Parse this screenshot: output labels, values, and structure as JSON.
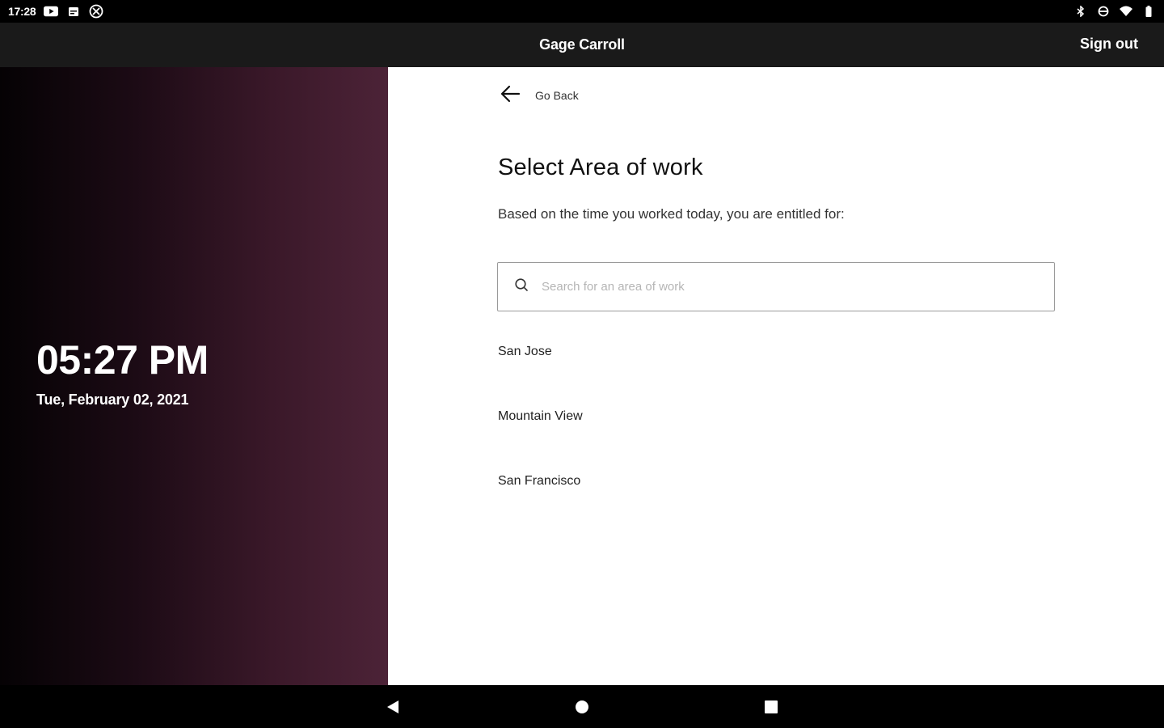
{
  "status_bar": {
    "time": "17:28",
    "left_icons": [
      "youtube-icon",
      "calendar-icon",
      "settings-badge-icon"
    ],
    "right_icons": [
      "bluetooth-icon",
      "data-saver-icon",
      "wifi-icon",
      "battery-icon"
    ]
  },
  "header": {
    "title": "Gage Carroll",
    "sign_out_label": "Sign out"
  },
  "clock": {
    "time": "05:27 PM",
    "date": "Tue, February 02, 2021"
  },
  "content": {
    "go_back_label": "Go Back",
    "title": "Select Area of work",
    "subtitle": "Based on the time you worked today, you are entitled for:",
    "search": {
      "placeholder": "Search for an area of work",
      "value": ""
    },
    "areas": [
      {
        "label": "San Jose"
      },
      {
        "label": "Mountain View"
      },
      {
        "label": "San Francisco"
      }
    ]
  },
  "nav_bar": {
    "buttons": [
      "back-icon",
      "home-icon",
      "recents-icon"
    ]
  },
  "colors": {
    "header_bg": "#1a1a1a",
    "panel_gradient_end": "#4c2337",
    "content_bg": "#ffffff"
  }
}
